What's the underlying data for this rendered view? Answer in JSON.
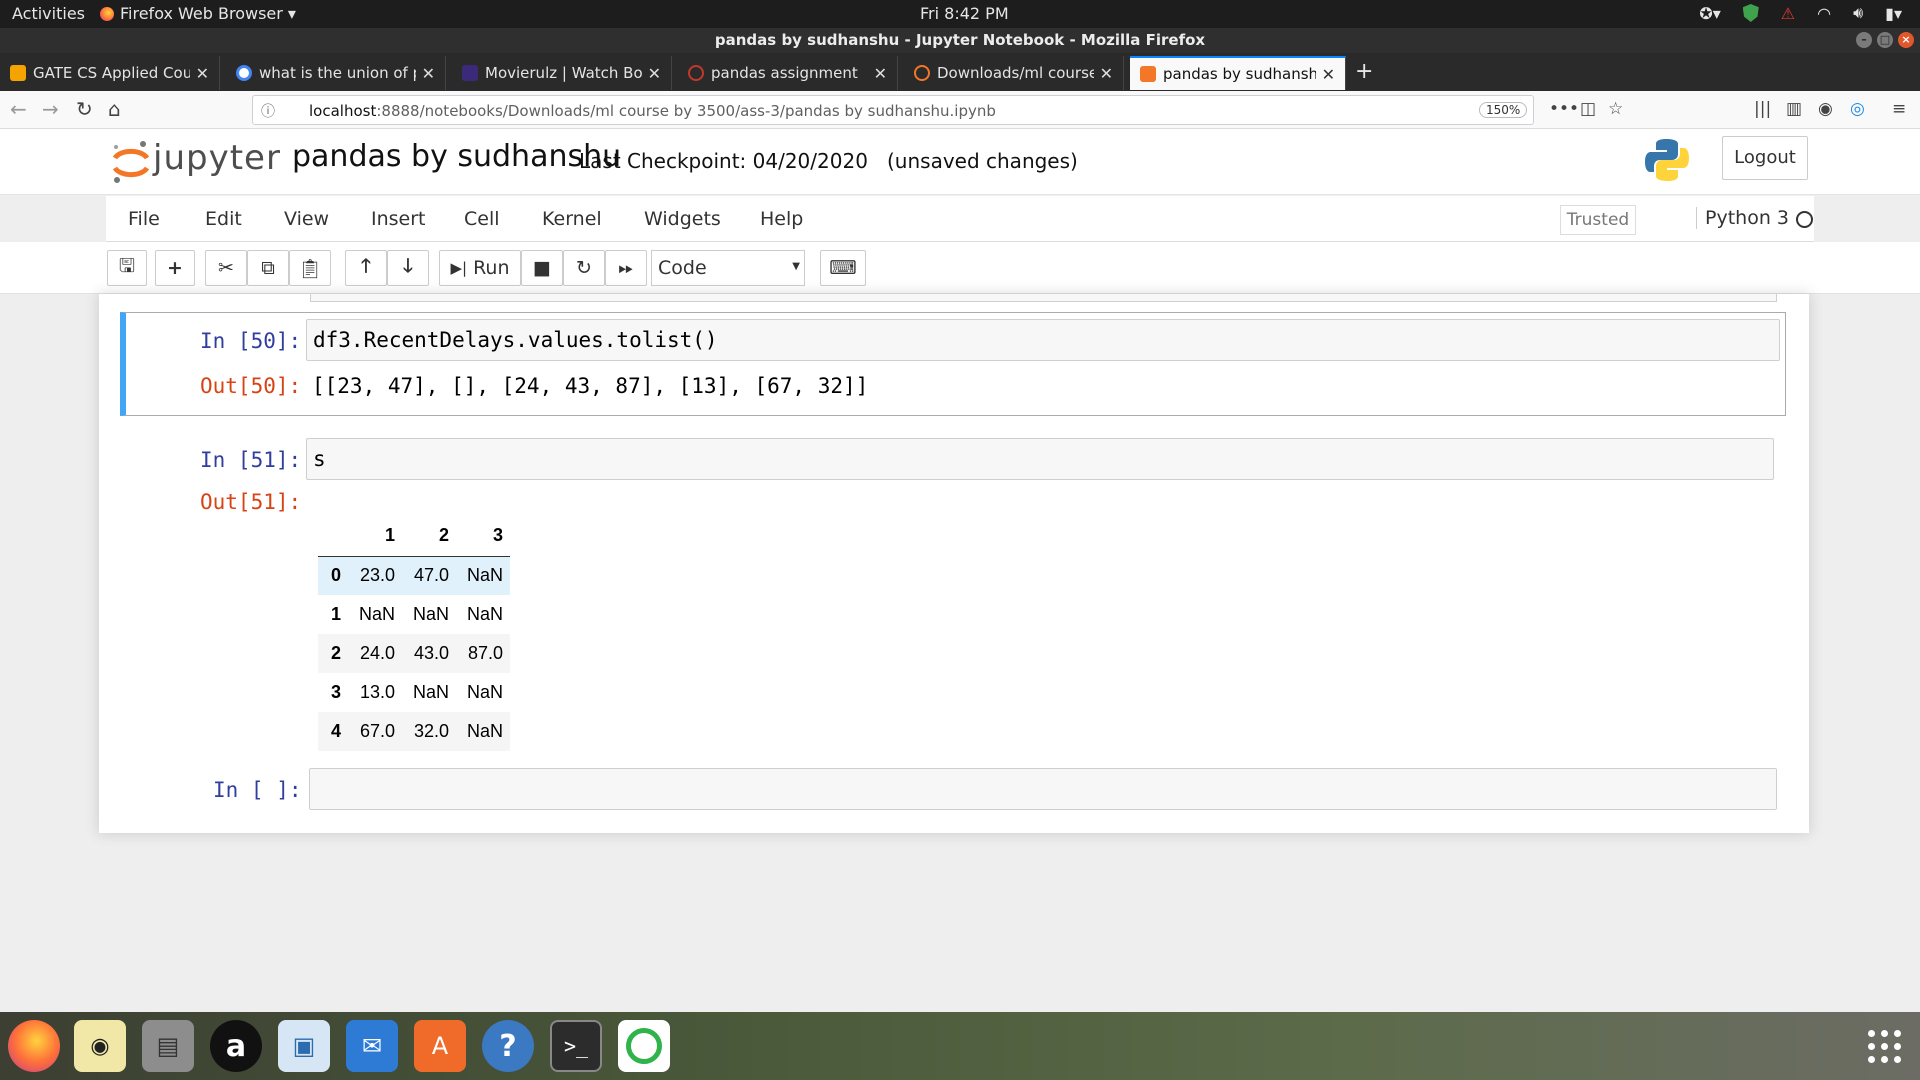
{
  "system_bar": {
    "activities": "Activities",
    "app_name": "Firefox Web Browser ▾",
    "clock": "Fri  8:42 PM"
  },
  "window": {
    "title": "pandas by sudhanshu - Jupyter Notebook - Mozilla Firefox"
  },
  "tabs": [
    {
      "label": "GATE CS Applied Course",
      "favicon_color": "#f4a300",
      "active": false
    },
    {
      "label": "what is the union of posi",
      "favicon_color": "#4285f4",
      "active": false
    },
    {
      "label": "Movierulz | Watch Bollyw",
      "favicon_color": "#3b2a7a",
      "active": false
    },
    {
      "label": "pandas assignment",
      "favicon_color": "#c0392b",
      "active": false
    },
    {
      "label": "Downloads/ml course by",
      "favicon_color": "#f37726",
      "active": false
    },
    {
      "label": "pandas by sudhanshu - Ju",
      "favicon_color": "#f37726",
      "active": true
    }
  ],
  "navbar": {
    "url_host": "localhost",
    "url_rest": ":8888/notebooks/Downloads/ml course by 3500/ass-3/pandas by sudhanshu.ipynb",
    "zoom": "150%"
  },
  "jupyter": {
    "logo_text": "jupyter",
    "notebook_name": "pandas by sudhanshu",
    "checkpoint": "Last Checkpoint: 04/20/2020   (unsaved changes)",
    "logout": "Logout",
    "brand_color": "#f37726"
  },
  "menubar": {
    "items": [
      "File",
      "Edit",
      "View",
      "Insert",
      "Cell",
      "Kernel",
      "Widgets",
      "Help"
    ],
    "trusted": "Trusted",
    "kernel": "Python 3"
  },
  "toolbar": {
    "run_label": "Run",
    "cell_type": "Code",
    "icons": [
      "save-icon",
      "plus-icon",
      "cut-icon",
      "copy-icon",
      "paste-icon",
      "arrow-up-icon",
      "arrow-down-icon",
      "run-icon",
      "stop-icon",
      "restart-icon",
      "fast-forward-icon",
      "keyboard-icon"
    ]
  },
  "cells": {
    "c50": {
      "in_prompt": "In [50]:",
      "code": "df3.RecentDelays.values.tolist()",
      "out_prompt": "Out[50]:",
      "output": "[[23, 47], [], [24, 43, 87], [13], [67, 32]]"
    },
    "c51": {
      "in_prompt": "In [51]:",
      "code": "s",
      "out_prompt": "Out[51]:",
      "table": {
        "columns": [
          "1",
          "2",
          "3"
        ],
        "rows": [
          {
            "index": "0",
            "values": [
              "23.0",
              "47.0",
              "NaN"
            ]
          },
          {
            "index": "1",
            "values": [
              "NaN",
              "NaN",
              "NaN"
            ]
          },
          {
            "index": "2",
            "values": [
              "24.0",
              "43.0",
              "87.0"
            ]
          },
          {
            "index": "3",
            "values": [
              "13.0",
              "NaN",
              "NaN"
            ]
          },
          {
            "index": "4",
            "values": [
              "67.0",
              "32.0",
              "NaN"
            ]
          }
        ]
      }
    },
    "empty": {
      "in_prompt": "In [ ]:"
    }
  },
  "dock": {
    "apps": [
      "firefox",
      "rhythmbox",
      "files",
      "amazon",
      "image-viewer",
      "thunderbird",
      "software-center",
      "help",
      "terminal",
      "ring-app"
    ]
  }
}
